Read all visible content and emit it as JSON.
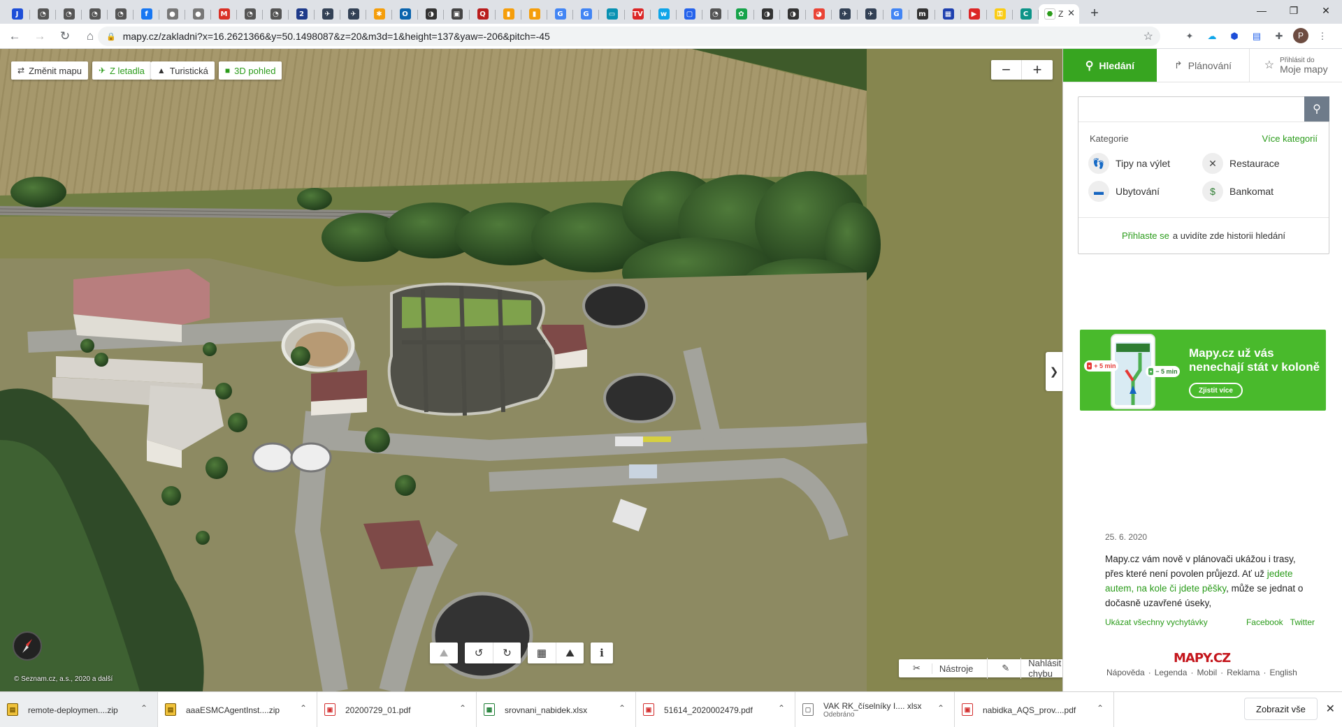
{
  "browser": {
    "tabs": [
      {
        "icon": "jira-icon",
        "color": "#1d4ed8",
        "glyph": "J"
      },
      {
        "icon": "o-icon",
        "color": "#555555",
        "glyph": "◔"
      },
      {
        "icon": "o-icon",
        "color": "#555555",
        "glyph": "◔"
      },
      {
        "icon": "o-icon",
        "color": "#555555",
        "glyph": "◔"
      },
      {
        "icon": "o-icon",
        "color": "#555555",
        "glyph": "◔"
      },
      {
        "icon": "facebook-icon",
        "color": "#1877f2",
        "glyph": "f"
      },
      {
        "icon": "apple-icon",
        "color": "#777777",
        "glyph": "●"
      },
      {
        "icon": "apple-icon",
        "color": "#777777",
        "glyph": "●"
      },
      {
        "icon": "gmail-icon",
        "color": "#d93025",
        "glyph": "M"
      },
      {
        "icon": "o-icon",
        "color": "#555555",
        "glyph": "◔"
      },
      {
        "icon": "o-icon",
        "color": "#555555",
        "glyph": "◔"
      },
      {
        "icon": "2-icon",
        "color": "#1e3a8a",
        "glyph": "2"
      },
      {
        "icon": "bird-icon",
        "color": "#334155",
        "glyph": "✈"
      },
      {
        "icon": "bird-icon",
        "color": "#334155",
        "glyph": "✈"
      },
      {
        "icon": "pinwheel-icon",
        "color": "#f59e0b",
        "glyph": "✱"
      },
      {
        "icon": "outlook-icon",
        "color": "#0a64ad",
        "glyph": "O"
      },
      {
        "icon": "ring-icon",
        "color": "#333333",
        "glyph": "◑"
      },
      {
        "icon": "box-icon",
        "color": "#444444",
        "glyph": "▣"
      },
      {
        "icon": "magnifier-icon",
        "color": "#b91c1c",
        "glyph": "Q"
      },
      {
        "icon": "chart-icon",
        "color": "#f59e0b",
        "glyph": "▮"
      },
      {
        "icon": "chart-icon",
        "color": "#f59e0b",
        "glyph": "▮"
      },
      {
        "icon": "google-icon",
        "color": "#4285f4",
        "glyph": "G"
      },
      {
        "icon": "google-icon",
        "color": "#4285f4",
        "glyph": "G"
      },
      {
        "icon": "tv-icon",
        "color": "#0891b2",
        "glyph": "▭"
      },
      {
        "icon": "tv-icon",
        "color": "#dc2626",
        "glyph": "TV"
      },
      {
        "icon": "wave-icon",
        "color": "#0ea5e9",
        "glyph": "w"
      },
      {
        "icon": "square-icon",
        "color": "#2563eb",
        "glyph": "▢"
      },
      {
        "icon": "o-icon",
        "color": "#555555",
        "glyph": "◔"
      },
      {
        "icon": "flower-icon",
        "color": "#16a34a",
        "glyph": "✿"
      },
      {
        "icon": "ring-icon",
        "color": "#333333",
        "glyph": "◑"
      },
      {
        "icon": "ring-icon",
        "color": "#333333",
        "glyph": "◑"
      },
      {
        "icon": "chrome-icon",
        "color": "#ea4335",
        "glyph": "◕"
      },
      {
        "icon": "bird-icon",
        "color": "#334155",
        "glyph": "✈"
      },
      {
        "icon": "bird-icon",
        "color": "#334155",
        "glyph": "✈"
      },
      {
        "icon": "google-icon",
        "color": "#4285f4",
        "glyph": "G"
      },
      {
        "icon": "m-icon",
        "color": "#333333",
        "glyph": "m"
      },
      {
        "icon": "news-icon",
        "color": "#1e40af",
        "glyph": "▦"
      },
      {
        "icon": "youtube-icon",
        "color": "#dc2626",
        "glyph": "▶"
      },
      {
        "icon": "key-icon",
        "color": "#facc15",
        "glyph": "⚿"
      },
      {
        "icon": "c-icon",
        "color": "#0d9488",
        "glyph": "C"
      }
    ],
    "active_tab": {
      "icon": "mapy-icon",
      "label": "Z",
      "close": "✕"
    },
    "new_tab": "+",
    "window_controls": {
      "minimize": "—",
      "restore": "❐",
      "close": "✕"
    },
    "url": "mapy.cz/zakladni?x=16.2621366&y=50.1498087&z=20&m3d=1&height=137&yaw=-206&pitch=-45",
    "profile_initial": "P"
  },
  "map": {
    "buttons": {
      "change_map": "Změnit mapu",
      "aerial": "Z letadla",
      "tourist": "Turistická",
      "view3d": "3D pohled"
    },
    "zoom": {
      "out": "−",
      "in": "+"
    },
    "collapse": "❯",
    "copyright": "© Seznam.cz, a.s., 2020 a další",
    "bottom_controls": {
      "terrain": "⛰",
      "rotate_left": "↺",
      "rotate_right": "↻",
      "grid": "▦",
      "tilt": "⛰",
      "info": "i"
    },
    "tools": "Nástroje",
    "report_error": "Nahlásit chybu"
  },
  "panel": {
    "tabs": {
      "search": "Hledání",
      "planning": "Plánování",
      "my_maps_small": "Přihlásit do",
      "my_maps": "Moje mapy"
    },
    "search": {
      "placeholder": "",
      "value": ""
    },
    "categories_label": "Kategorie",
    "more_categories": "Více kategorií",
    "categories": [
      {
        "label": "Tipy na výlet",
        "icon": "footprints-icon",
        "glyph": "👣",
        "color": "#d32f2f"
      },
      {
        "label": "Restaurace",
        "icon": "cutlery-icon",
        "glyph": "✕",
        "color": "#444444"
      },
      {
        "label": "Ubytování",
        "icon": "bed-icon",
        "glyph": "▬",
        "color": "#1565c0"
      },
      {
        "label": "Bankomat",
        "icon": "atm-icon",
        "glyph": "$",
        "color": "#2e7d32"
      }
    ],
    "login_link": "Přihlaste se",
    "login_text": "a uvidíte zde historii hledání",
    "banner": {
      "title": "Mapy.cz už vás nenechají stát v koloně",
      "cta": "Zjistit více",
      "pill_plus": "+ 5 min",
      "pill_minus": "− 5 min"
    },
    "news": {
      "date": "25. 6. 2020",
      "text1": "Mapy.cz vám nově v plánovači ukážou i trasy, přes které není povolen průjezd. Ať už",
      "link": "jedete autem, na kole či jdete pěšky",
      "text2": ", může se jednat o dočasně uzavřené úseky,"
    },
    "show_all_tips": "Ukázat všechny vychytávky",
    "facebook": "Facebook",
    "twitter": "Twitter",
    "logo": "MAPY.CZ",
    "footer": [
      "Nápověda",
      "Legenda",
      "Mobil",
      "Reklama",
      "English"
    ]
  },
  "downloads": {
    "items": [
      {
        "name": "remote-deploymen....zip",
        "icon": "zip-icon",
        "type": "zip",
        "sub": ""
      },
      {
        "name": "aaaESMCAgentInst....zip",
        "icon": "zip-icon",
        "type": "zip",
        "sub": ""
      },
      {
        "name": "20200729_01.pdf",
        "icon": "pdf-icon",
        "type": "pdf",
        "sub": ""
      },
      {
        "name": "srovnani_nabidek.xlsx",
        "icon": "excel-icon",
        "type": "xlsx",
        "sub": ""
      },
      {
        "name": "51614_2020002479.pdf",
        "icon": "pdf-icon",
        "type": "pdf",
        "sub": ""
      },
      {
        "name": "VAK RK_číselníky I.... xlsx",
        "icon": "file-icon",
        "type": "removed",
        "sub": "Odebráno"
      },
      {
        "name": "nabidka_AQS_prov....pdf",
        "icon": "pdf-icon",
        "type": "pdf",
        "sub": ""
      }
    ],
    "show_all": "Zobrazit vše",
    "close": "✕"
  }
}
